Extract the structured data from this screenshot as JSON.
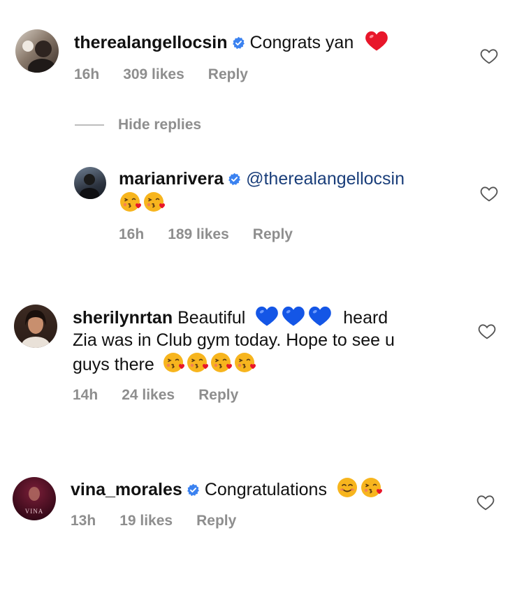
{
  "comments": [
    {
      "username": "therealangellocsin",
      "verified": true,
      "text": "Congrats yan",
      "emoji": [
        "red-heart"
      ],
      "time": "16h",
      "likes": "309 likes",
      "reply": "Reply"
    },
    {
      "username": "marianrivera",
      "verified": true,
      "mention": "@therealangellocsin",
      "emoji": [
        "face-blowing-kiss",
        "face-blowing-kiss"
      ],
      "time": "16h",
      "likes": "189 likes",
      "reply": "Reply"
    },
    {
      "username": "sherilynrtan",
      "verified": false,
      "text_before_emoji": "Beautiful",
      "emoji_inline": [
        "blue-heart",
        "blue-heart",
        "blue-heart"
      ],
      "text_after_emoji_line1": "heard",
      "text_line2": "Zia was in Club gym today. Hope to see u",
      "text_line3": "guys there",
      "emoji_end": [
        "face-blowing-kiss",
        "face-blowing-kiss",
        "face-blowing-kiss",
        "face-blowing-kiss"
      ],
      "time": "14h",
      "likes": "24 likes",
      "reply": "Reply"
    },
    {
      "username": "vina_morales",
      "verified": true,
      "text": "Congratulations",
      "emoji": [
        "smiling-face",
        "face-blowing-kiss"
      ],
      "avatar_text": "VINA",
      "time": "13h",
      "likes": "19 likes",
      "reply": "Reply"
    }
  ],
  "hide_replies_label": "Hide replies",
  "colors": {
    "verified_blue": "#3b82f0",
    "meta_gray": "#8e8e8e",
    "heart_red": "#e8162a",
    "blue_heart": "#1456e6",
    "emoji_yellow": "#f7b51e"
  }
}
